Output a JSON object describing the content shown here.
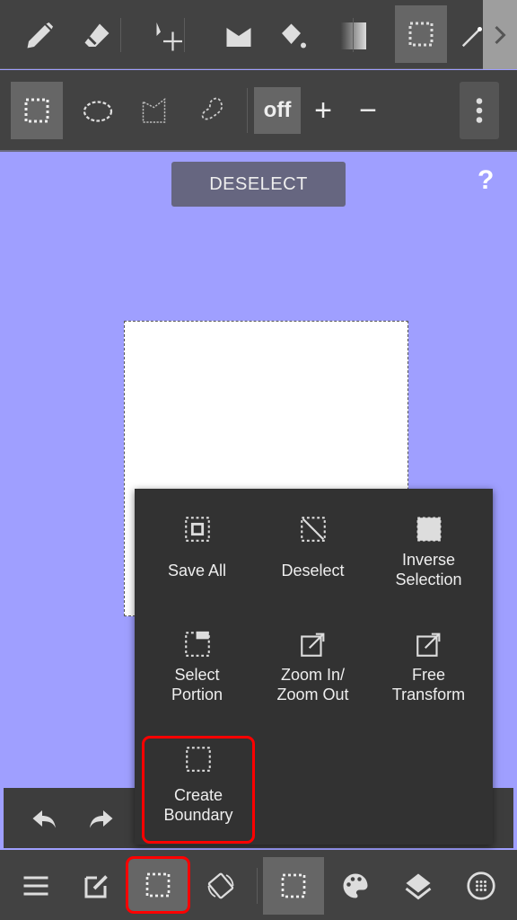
{
  "top_toolbar": {
    "tools": [
      "pen-icon",
      "eraser-icon",
      "move-icon",
      "fill-shape-icon",
      "bucket-icon",
      "gradient-icon",
      "selection-icon",
      "magic-wand-icon"
    ],
    "active": "selection-icon"
  },
  "selection_toolbar": {
    "tools": [
      "rect-select-icon",
      "ellipse-select-icon",
      "polygon-select-icon",
      "lasso-select-icon"
    ],
    "mode_label": "off",
    "plus": "+",
    "minus": "−"
  },
  "canvas_area": {
    "deselect_label": "DESELECT",
    "help": "?",
    "background": "#9f9fff"
  },
  "menu": {
    "items": [
      {
        "label": "Save All"
      },
      {
        "label": "Deselect"
      },
      {
        "label": "Inverse\nSelection"
      },
      {
        "label": "Select\nPortion"
      },
      {
        "label": "Zoom In/\nZoom Out"
      },
      {
        "label": "Free\nTransform"
      },
      {
        "label": "Create\nBoundary",
        "highlighted": true
      }
    ]
  },
  "bottom_toolbar": {
    "items": [
      "menu-icon",
      "edit-icon",
      "selection-icon",
      "rotate-icon",
      "selection-layer-icon",
      "palette-icon",
      "layers-icon",
      "materials-icon"
    ]
  },
  "highlight_color": "#ff0000"
}
